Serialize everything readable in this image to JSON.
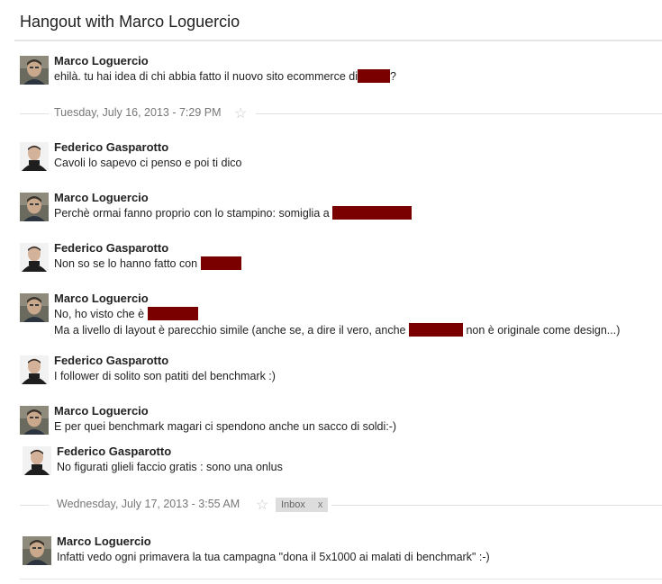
{
  "header": {
    "title": "Hangout with Marco Loguercio"
  },
  "dividers": [
    {
      "timestamp": "Tuesday, July 16, 2013 - 7:29 PM"
    },
    {
      "timestamp": "Wednesday, July 17, 2013 - 3:55 AM",
      "label": "Inbox",
      "label_remove": "x"
    }
  ],
  "messages": [
    {
      "sender": "Marco Loguercio",
      "avatar": "avatar-marco",
      "lines": [
        {
          "before": "ehilà. tu hai idea di chi abbia fatto il nuovo sito ecommerce di",
          "after": "?"
        }
      ]
    },
    {
      "sender": "Federico Gasparotto",
      "avatar": "avatar-federico",
      "lines": [
        {
          "before": "Cavoli lo sapevo ci penso e poi ti dico"
        }
      ]
    },
    {
      "sender": "Marco Loguercio",
      "avatar": "avatar-marco",
      "lines": [
        {
          "before": "Perchè ormai fanno proprio con lo stampino: somiglia a"
        }
      ]
    },
    {
      "sender": "Federico Gasparotto",
      "avatar": "avatar-federico",
      "lines": [
        {
          "before": "Non so se lo hanno fatto con"
        }
      ]
    },
    {
      "sender": "Marco Loguercio",
      "avatar": "avatar-marco",
      "lines": [
        {
          "before": "No, ho visto che è"
        },
        {
          "before": "Ma a livello di layout è parecchio simile (anche se, a dire il vero, anche",
          "after": "non è originale come design...)"
        }
      ]
    },
    {
      "sender": "Federico Gasparotto",
      "avatar": "avatar-federico",
      "lines": [
        {
          "before": "I follower di solito son patiti del benchmark :)"
        }
      ]
    },
    {
      "sender": "Marco Loguercio",
      "avatar": "avatar-marco",
      "lines": [
        {
          "before": "E per quei benchmark magari ci spendono anche un sacco di soldi:-)"
        }
      ]
    },
    {
      "sender": "Federico Gasparotto",
      "avatar": "avatar-federico",
      "lines": [
        {
          "before": "No figurati glieli faccio gratis : sono una onlus"
        }
      ]
    },
    {
      "sender": "Marco Loguercio",
      "avatar": "avatar-marco",
      "lines": [
        {
          "before": "Infatti vedo ogni primavera la tua campagna \"dona il 5x1000 ai malati di benchmark\" :-)"
        }
      ]
    }
  ],
  "colors": {
    "redaction": "#7a0000",
    "divider_text": "#777777",
    "star_outline": "#c8c8c8",
    "label_bg": "#dddddd"
  },
  "icons": {
    "star": "star-outline-icon",
    "remove_label": "close-icon"
  }
}
